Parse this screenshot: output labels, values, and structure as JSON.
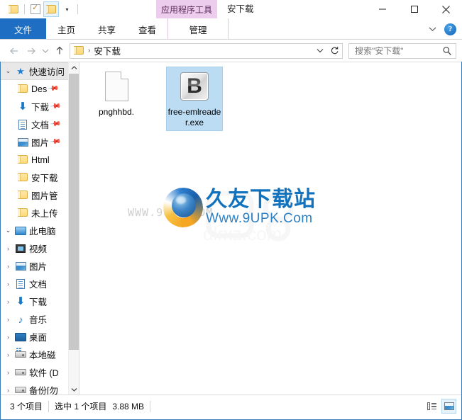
{
  "window": {
    "title": "安下载",
    "contextual_tab_group": "应用程序工具",
    "controls": {
      "minimize": "minimize-icon",
      "maximize": "maximize-icon",
      "close": "close-icon"
    }
  },
  "quick_access_toolbar": {
    "items": [
      {
        "name": "folder-icon",
        "label": ""
      },
      {
        "name": "properties-icon",
        "label": ""
      },
      {
        "name": "new-folder-icon",
        "label": ""
      },
      {
        "name": "customize-caret-icon",
        "label": "▾"
      }
    ]
  },
  "ribbon": {
    "tabs": [
      {
        "label": "文件",
        "active": true,
        "style": "file"
      },
      {
        "label": "主页",
        "active": false,
        "style": "normal"
      },
      {
        "label": "共享",
        "active": false,
        "style": "normal"
      },
      {
        "label": "查看",
        "active": false,
        "style": "normal"
      },
      {
        "label": "管理",
        "active": false,
        "style": "contextual"
      }
    ],
    "collapse_icon": "chevron-down-icon",
    "help_label": "?"
  },
  "address_bar": {
    "back_icon": "back-arrow-icon",
    "forward_icon": "forward-arrow-icon",
    "recent_icon": "recent-locations-chevron-icon",
    "up_icon": "up-arrow-icon",
    "breadcrumb": {
      "folder_icon": "folder-icon",
      "separator": "›",
      "path": "安下载"
    },
    "dropdown_icon": "chevron-down-icon",
    "refresh_icon": "refresh-icon",
    "search": {
      "placeholder": "搜索\"安下载\"",
      "icon": "search-icon"
    }
  },
  "nav_pane": {
    "groups": [
      {
        "label": "快速访问",
        "icon": "pin-star-icon",
        "expanded": true,
        "selected": true,
        "children": [
          {
            "label": "Des",
            "icon": "folder-icon",
            "pinned": true
          },
          {
            "label": "下载",
            "icon": "download-arrow-icon",
            "pinned": true
          },
          {
            "label": "文档",
            "icon": "documents-icon",
            "pinned": true
          },
          {
            "label": "图片",
            "icon": "pictures-icon",
            "pinned": true
          },
          {
            "label": "Html",
            "icon": "folder-icon",
            "pinned": false
          },
          {
            "label": "安下载",
            "icon": "folder-icon",
            "pinned": false
          },
          {
            "label": "图片管",
            "icon": "folder-icon",
            "pinned": false
          },
          {
            "label": "未上传",
            "icon": "folder-icon",
            "pinned": false
          }
        ]
      },
      {
        "label": "此电脑",
        "icon": "this-pc-icon",
        "expanded": true,
        "selected": false,
        "children": [
          {
            "label": "视频",
            "icon": "videos-icon",
            "collapsible": true
          },
          {
            "label": "图片",
            "icon": "pictures-icon",
            "collapsible": true
          },
          {
            "label": "文档",
            "icon": "documents-icon",
            "collapsible": true
          },
          {
            "label": "下载",
            "icon": "download-arrow-icon",
            "collapsible": true
          },
          {
            "label": "音乐",
            "icon": "music-note-icon",
            "collapsible": true
          },
          {
            "label": "桌面",
            "icon": "desktop-icon",
            "collapsible": true
          },
          {
            "label": "本地磁",
            "icon": "system-drive-icon",
            "collapsible": true
          },
          {
            "label": "软件 (D",
            "icon": "drive-icon",
            "collapsible": true
          },
          {
            "label": "备份[勿",
            "icon": "drive-icon",
            "collapsible": true
          }
        ]
      }
    ],
    "scrollbar": {
      "up_arrow": "scroll-up-icon",
      "down_arrow": "scroll-down-icon"
    }
  },
  "files": [
    {
      "name": "pnghhbd.",
      "icon": "blank-document-icon",
      "selected": false
    },
    {
      "name": "free-emlreader.exe",
      "icon": "exe-b-icon",
      "icon_letter": "B",
      "selected": true
    }
  ],
  "watermark": {
    "trace_text": "WWW.9UPK.COM",
    "brand_cn": "久友下载站",
    "brand_en": "Www.9UPK.Com"
  },
  "status_bar": {
    "item_count": "3 个项目",
    "selection": "选中 1 个项目",
    "size": "3.88 MB",
    "views": [
      {
        "name": "details-view-button",
        "icon": "details-view-icon",
        "active": false
      },
      {
        "name": "thumbnail-view-button",
        "icon": "thumbnail-view-icon",
        "active": true
      }
    ]
  },
  "colors": {
    "accent": "#1e6fc4",
    "selection": "#bcdcf4",
    "contextual": "#edcded",
    "brand_blue": "#1272bd"
  }
}
